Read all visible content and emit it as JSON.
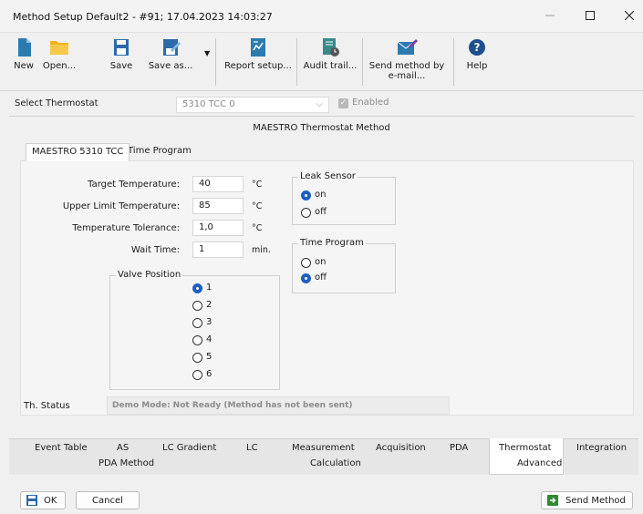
{
  "window": {
    "title": "Method Setup Default2 - #91;  17.04.2023  14:03:27",
    "controls": [
      "minimize-icon",
      "maximize-icon",
      "close-icon"
    ]
  },
  "toolbar": {
    "new": "New",
    "open": "Open...",
    "save": "Save",
    "save_as": "Save as...",
    "report_setup": "Report setup...",
    "audit_trail": "Audit trail...",
    "send_method_line1": "Send method by",
    "send_method_line2": "e-mail...",
    "help": "Help"
  },
  "thermostat": {
    "label": "Select Thermostat",
    "selected": "5310 TCC 0",
    "enabled_label": "Enabled",
    "enabled_checked": true
  },
  "method": {
    "title": "MAESTRO Thermostat Method",
    "tabs": [
      "MAESTRO 5310 TCC",
      "Time Program"
    ],
    "active_tab": 0,
    "fields": {
      "target_temp": {
        "label": "Target Temperature:",
        "value": "40",
        "unit": "°C"
      },
      "upper_limit": {
        "label": "Upper Limit Temperature:",
        "value": "85",
        "unit": "°C"
      },
      "tolerance": {
        "label": "Temperature Tolerance:",
        "value": "1,0",
        "unit": "°C"
      },
      "wait_time": {
        "label": "Wait Time:",
        "value": "1",
        "unit": "min."
      }
    },
    "valve": {
      "title": "Valve Position",
      "options": [
        "1",
        "2",
        "3",
        "4",
        "5",
        "6"
      ],
      "selected": "1"
    },
    "leak_sensor": {
      "title": "Leak Sensor",
      "on": "on",
      "off": "off",
      "selected": "on"
    },
    "time_program": {
      "title": "Time Program",
      "on": "on",
      "off": "off",
      "selected": "off"
    },
    "status": {
      "label": "Th. Status",
      "text": "Demo Mode: Not Ready (Method has not been sent)"
    }
  },
  "bottom_tabs": {
    "row1": [
      "Event Table",
      "AS",
      "LC Gradient",
      "LC",
      "Measurement",
      "Acquisition",
      "PDA",
      "Thermostat",
      "Integration"
    ],
    "row2": [
      "PDA Method",
      "Calculation",
      "Advanced"
    ],
    "active": "Thermostat"
  },
  "footer": {
    "ok": "OK",
    "cancel": "Cancel",
    "send_method": "Send Method"
  },
  "colors": {
    "accent_blue": "#1f5fbf",
    "folder_yellow": "#f2b31b",
    "icon_teal": "#2c7bb0",
    "send_green": "#2e8b2e"
  }
}
